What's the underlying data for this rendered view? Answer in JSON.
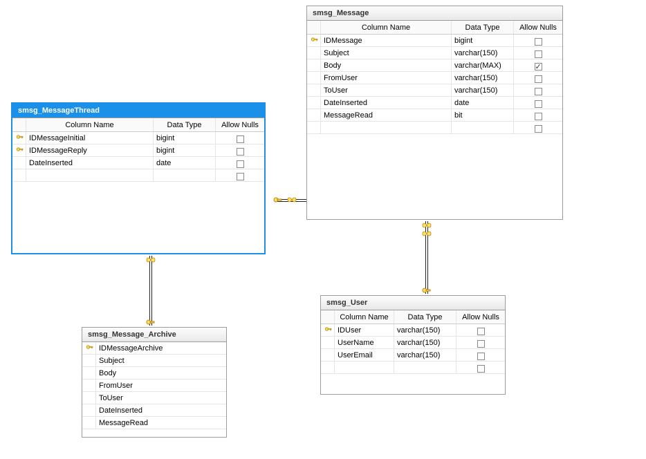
{
  "headers": {
    "column_name": "Column Name",
    "data_type": "Data Type",
    "allow_nulls": "Allow Nulls"
  },
  "tables": {
    "message": {
      "title": "smsg_Message",
      "rows": [
        {
          "key": true,
          "name": "IDMessage",
          "type": "bigint",
          "null": false
        },
        {
          "key": false,
          "name": "Subject",
          "type": "varchar(150)",
          "null": false
        },
        {
          "key": false,
          "name": "Body",
          "type": "varchar(MAX)",
          "null": true
        },
        {
          "key": false,
          "name": "FromUser",
          "type": "varchar(150)",
          "null": false
        },
        {
          "key": false,
          "name": "ToUser",
          "type": "varchar(150)",
          "null": false
        },
        {
          "key": false,
          "name": "DateInserted",
          "type": "date",
          "null": false
        },
        {
          "key": false,
          "name": "MessageRead",
          "type": "bit",
          "null": false
        },
        {
          "key": false,
          "name": "",
          "type": "",
          "null": false
        }
      ]
    },
    "thread": {
      "title": "smsg_MessageThread",
      "rows": [
        {
          "key": true,
          "name": "IDMessageInitial",
          "type": "bigint",
          "null": false
        },
        {
          "key": true,
          "name": "IDMessageReply",
          "type": "bigint",
          "null": false
        },
        {
          "key": false,
          "name": "DateInserted",
          "type": "date",
          "null": false
        },
        {
          "key": false,
          "name": "",
          "type": "",
          "null": false
        }
      ]
    },
    "user": {
      "title": "smsg_User",
      "rows": [
        {
          "key": true,
          "name": "IDUser",
          "type": "varchar(150)",
          "null": false
        },
        {
          "key": false,
          "name": "UserName",
          "type": "varchar(150)",
          "null": false
        },
        {
          "key": false,
          "name": "UserEmail",
          "type": "varchar(150)",
          "null": false
        },
        {
          "key": false,
          "name": "",
          "type": "",
          "null": false
        }
      ]
    },
    "archive": {
      "title": "smsg_Message_Archive",
      "rows": [
        {
          "key": true,
          "name": "IDMessageArchive"
        },
        {
          "key": false,
          "name": "Subject"
        },
        {
          "key": false,
          "name": "Body"
        },
        {
          "key": false,
          "name": "FromUser"
        },
        {
          "key": false,
          "name": "ToUser"
        },
        {
          "key": false,
          "name": "DateInserted"
        },
        {
          "key": false,
          "name": "MessageRead"
        }
      ]
    }
  }
}
